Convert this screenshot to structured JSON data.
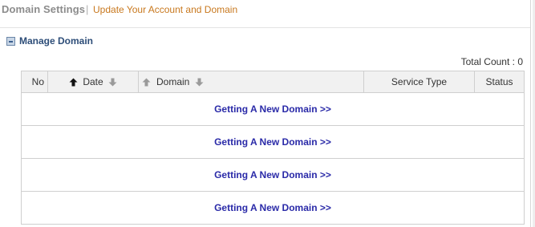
{
  "header": {
    "title": "Domain Settings",
    "separator": "|",
    "subtitle": "Update Your Account and Domain"
  },
  "section": {
    "icon": "collapse-box-icon",
    "title": "Manage Domain"
  },
  "summary": {
    "total_label": "Total Count : ",
    "total_value": "0"
  },
  "table": {
    "columns": {
      "no": "No",
      "date": "Date",
      "domain": "Domain",
      "service_type": "Service Type",
      "status": "Status"
    },
    "rows": [
      {
        "link": "Getting A New Domain >>"
      },
      {
        "link": "Getting A New Domain >>"
      },
      {
        "link": "Getting A New Domain >>"
      },
      {
        "link": "Getting A New Domain >>"
      }
    ]
  },
  "colors": {
    "title_gray": "#8c8c8c",
    "subtitle_orange": "#c8781e",
    "section_blue": "#2d4d78",
    "link_blue": "#2a2aa8",
    "header_bg": "#f1f1f1",
    "border": "#cfcfcf"
  }
}
